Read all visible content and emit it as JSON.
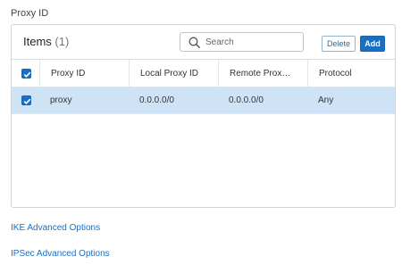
{
  "section": {
    "title": "Proxy ID"
  },
  "panel": {
    "title": "Items",
    "count": "(1)",
    "search_placeholder": "Search",
    "delete_label": "Delete",
    "add_label": "Add"
  },
  "table": {
    "columns": [
      "Proxy ID",
      "Local Proxy ID",
      "Remote Prox…",
      "Protocol"
    ],
    "header_checked": true,
    "rows": [
      {
        "checked": true,
        "proxy_id": "proxy",
        "local": "0.0.0.0/0",
        "remote": "0.0.0.0/0",
        "protocol": "Any",
        "selected": true
      }
    ]
  },
  "links": {
    "ike": "IKE Advanced Options",
    "ipsec": "IPSec Advanced Options"
  },
  "colors": {
    "accent": "#1a6fc2",
    "selected_row": "#cfe3f7",
    "border": "#cfd4d9"
  },
  "icons": {
    "search": "search-icon",
    "checkbox": "checkmark-icon"
  }
}
